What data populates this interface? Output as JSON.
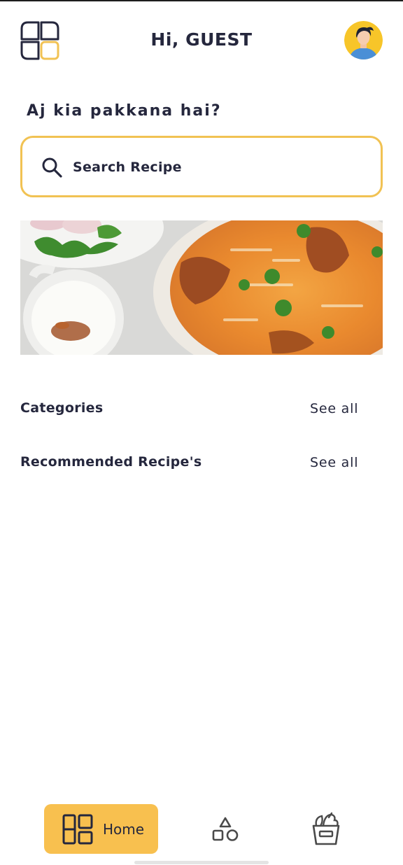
{
  "header": {
    "greeting": "Hi, GUEST",
    "logo_icon": "grid-logo-icon",
    "avatar_icon": "user-avatar-icon"
  },
  "main": {
    "subtitle": "Aj kia pakkana hai?",
    "search": {
      "placeholder": "Search Recipe",
      "icon": "search-icon"
    },
    "banner_image": "biryani-banner",
    "sections": [
      {
        "title": "Categories",
        "action": "See all"
      },
      {
        "title": "Recommended Recipe's",
        "action": "See all"
      }
    ]
  },
  "bottom_nav": {
    "items": [
      {
        "label": "Home",
        "icon": "home-grid-icon",
        "active": true
      },
      {
        "label": "",
        "icon": "shapes-icon",
        "active": false
      },
      {
        "label": "",
        "icon": "grocery-basket-icon",
        "active": false
      }
    ]
  },
  "colors": {
    "accent": "#f8c04f",
    "search_border": "#f1c253",
    "text_dark": "#25273d",
    "avatar_bg": "#f7c529"
  }
}
